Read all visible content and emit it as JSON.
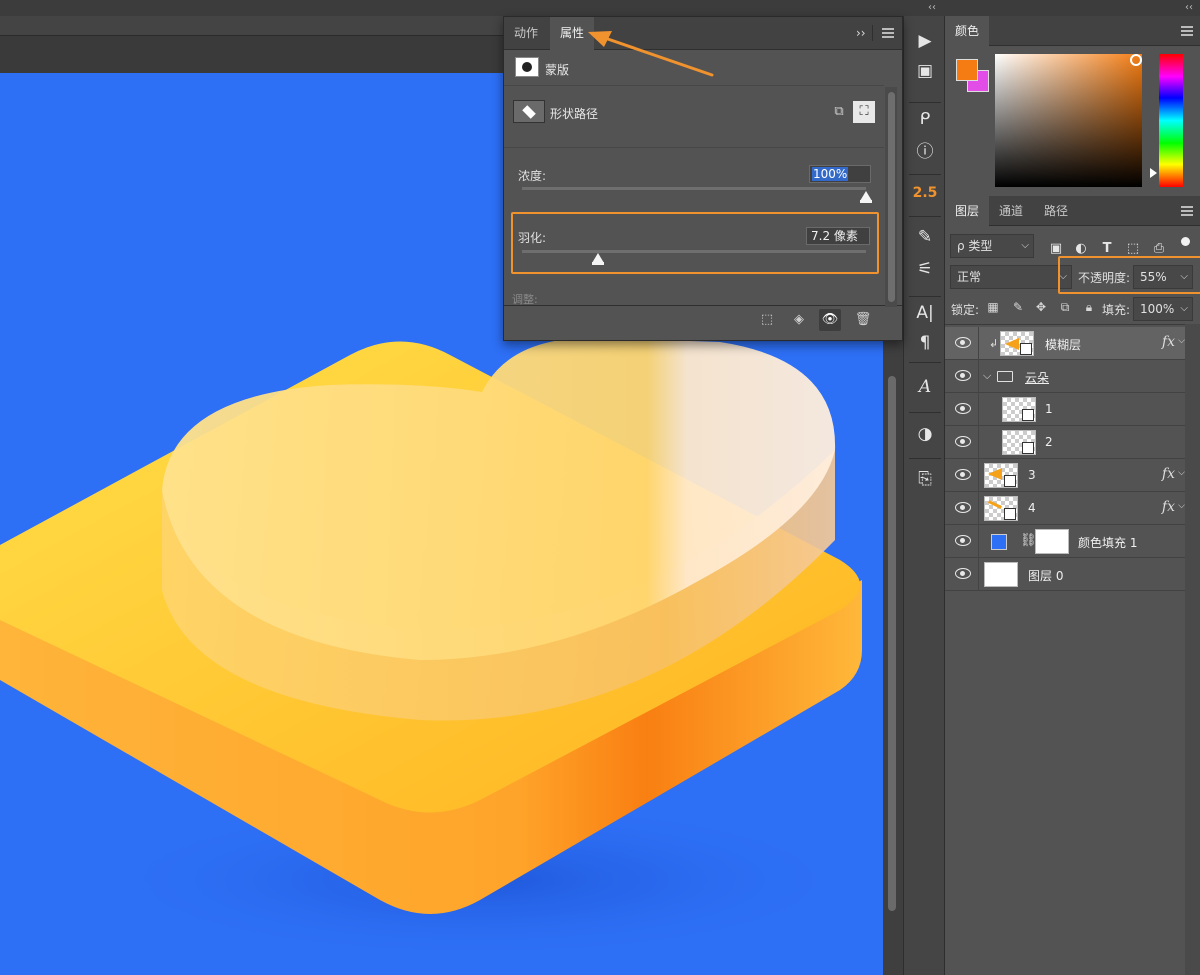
{
  "properties_panel": {
    "tabs": [
      {
        "label": "动作",
        "active": false
      },
      {
        "label": "属性",
        "active": true
      }
    ],
    "expand_label": "›› ",
    "mask_label": "蒙版",
    "shape_path_label": "形状路径",
    "density": {
      "label": "浓度:",
      "value": "100%",
      "level": 1.0
    },
    "feather": {
      "label": "羽化:",
      "value": "7.2 像素",
      "level": 0.22
    },
    "adjust_label": "调整:"
  },
  "toolbar": {
    "number_label": "2.5"
  },
  "color_panel": {
    "tab": "颜色",
    "foreground": "#f47c12",
    "background": "#e24de8"
  },
  "layers_panel": {
    "tabs": [
      {
        "label": "图层",
        "active": true
      },
      {
        "label": "通道",
        "active": false
      },
      {
        "label": "路径",
        "active": false
      }
    ],
    "filter_label": "ρ 类型",
    "blend_mode": "正常",
    "opacity_label": "不透明度:",
    "opacity_value": "55%",
    "lock_label": "锁定:",
    "fill_label": "填充:",
    "fill_value": "100%",
    "layers": [
      {
        "name": "模糊层",
        "has_fx": true
      },
      {
        "name": "云朵"
      },
      {
        "name": "1"
      },
      {
        "name": "2"
      },
      {
        "name": "3",
        "has_fx": true
      },
      {
        "name": "4",
        "has_fx": true
      },
      {
        "name": "颜色填充 1"
      },
      {
        "name": "图层 0"
      }
    ],
    "fx_label": "fx"
  },
  "colors": {
    "accent_annotation": "#f0922e",
    "canvas_blue": "#2d6ff5",
    "icon_yellow": "#ffc629",
    "icon_orange": "#f98a1a"
  }
}
